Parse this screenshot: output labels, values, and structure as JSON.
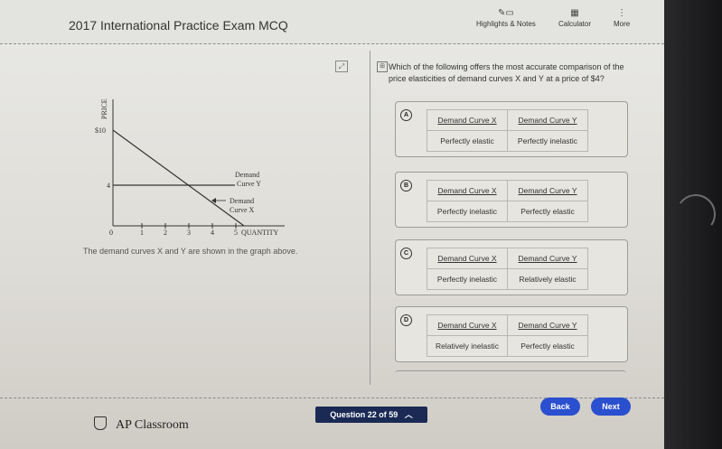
{
  "header": {
    "exam_title": "2017 International Practice Exam MCQ",
    "tools": [
      {
        "label": "Highlights & Notes",
        "icon": "highlighter-icon"
      },
      {
        "label": "Calculator",
        "icon": "calculator-icon"
      },
      {
        "label": "More",
        "icon": "kebab-menu-icon"
      }
    ]
  },
  "stimulus": {
    "caption": "The demand curves X and Y are shown in the graph above.",
    "graph": {
      "y_axis_label": "PRICE",
      "x_axis_label": "QUANTITY",
      "y_ticks": [
        "$10",
        "4"
      ],
      "x_ticks": [
        "0",
        "1",
        "2",
        "3",
        "4",
        "5"
      ],
      "curve_y_label_1": "Demand",
      "curve_y_label_2": "Curve Y",
      "curve_x_label_1": "Demand",
      "curve_x_label_2": "Curve X"
    }
  },
  "question": {
    "text": "Which of the following offers the most accurate comparison of the price elasticities of demand curves X and Y at a price of $4?",
    "options": [
      {
        "letter": "A",
        "x_head": "Demand Curve X",
        "y_head": "Demand Curve Y",
        "x_val": "Perfectly elastic",
        "y_val": "Perfectly inelastic"
      },
      {
        "letter": "B",
        "x_head": "Demand Curve X",
        "y_head": "Demand Curve Y",
        "x_val": "Perfectly inelastic",
        "y_val": "Perfectly elastic"
      },
      {
        "letter": "C",
        "x_head": "Demand Curve X",
        "y_head": "Demand Curve Y",
        "x_val": "Perfectly inelastic",
        "y_val": "Relatively elastic"
      },
      {
        "letter": "D",
        "x_head": "Demand Curve X",
        "y_head": "Demand Curve Y",
        "x_val": "Relatively inelastic",
        "y_val": "Perfectly elastic"
      }
    ]
  },
  "footer": {
    "brand": "AP Classroom",
    "question_nav": "Question 22 of 59",
    "back_label": "Back",
    "next_label": "Next"
  },
  "colors": {
    "primary_button": "#2a4fcf",
    "nav_bar": "#1a2a55"
  }
}
